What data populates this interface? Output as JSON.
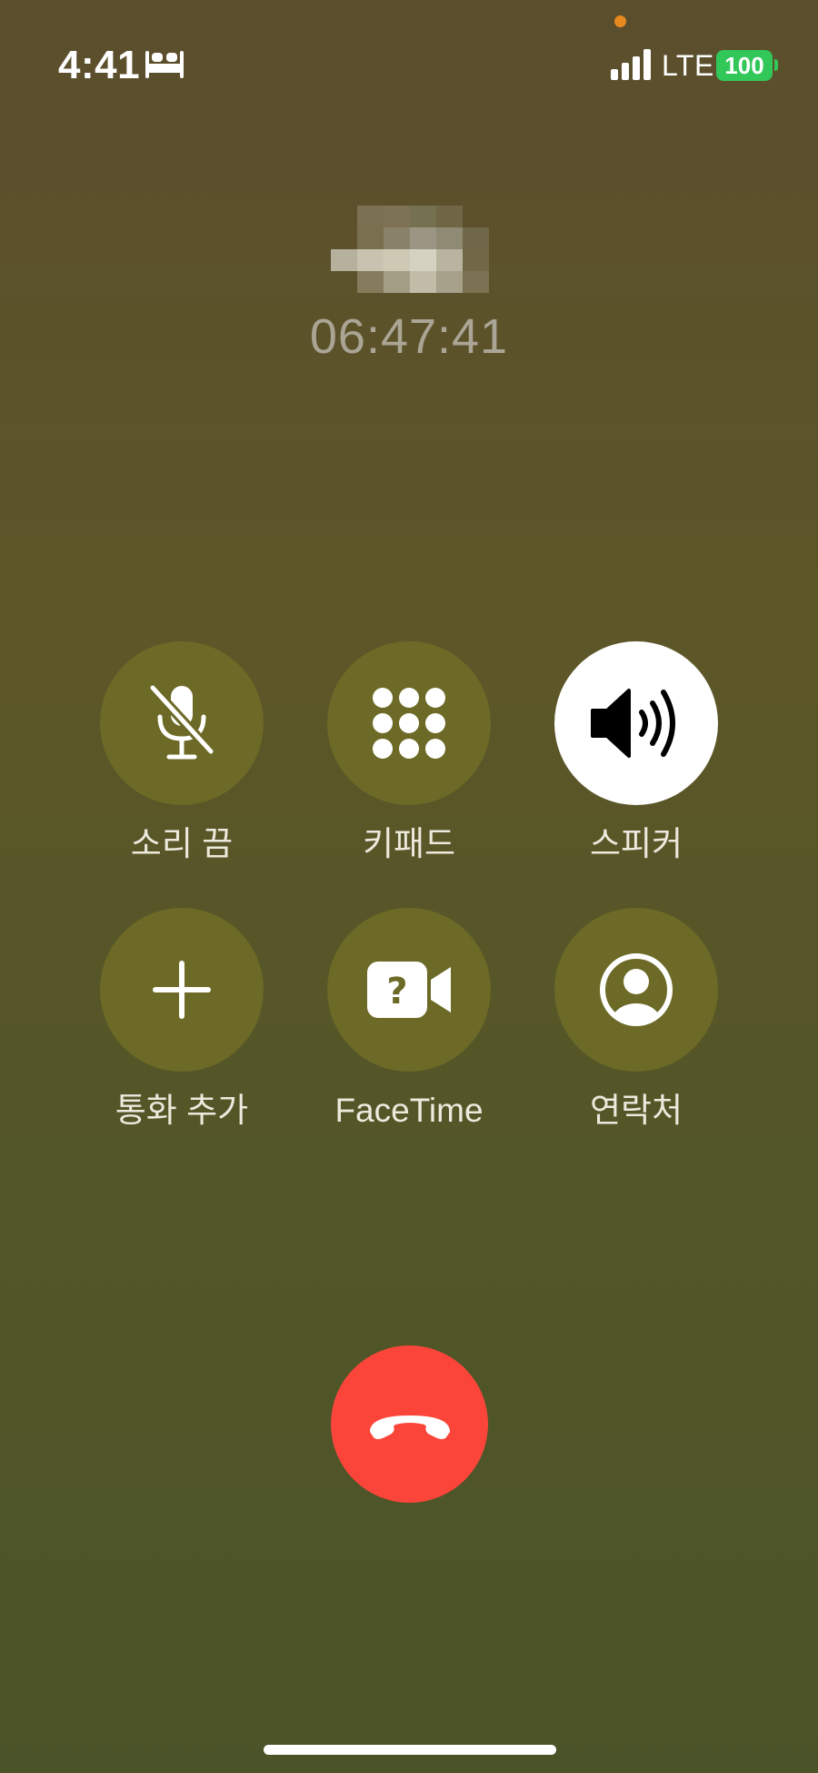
{
  "status_bar": {
    "time": "4:41",
    "network": "LTE",
    "battery_level": "100",
    "focus_icon": "bed-icon",
    "signal_icon": "cellular-signal-icon",
    "battery_color": "#32c759",
    "privacy_indicator_color": "#e8891f"
  },
  "call": {
    "caller_icon": "pixelated-caller-name",
    "duration": "06:47:41"
  },
  "controls": [
    {
      "label": "소리 끔",
      "icon": "mic-slash-icon",
      "active": false
    },
    {
      "label": "키패드",
      "icon": "keypad-icon",
      "active": false
    },
    {
      "label": "스피커",
      "icon": "speaker-wave-icon",
      "active": true
    },
    {
      "label": "통화 추가",
      "icon": "plus-icon",
      "active": false
    },
    {
      "label": "FaceTime",
      "icon": "facetime-video-icon",
      "active": false
    },
    {
      "label": "연락처",
      "icon": "contact-person-icon",
      "active": false
    }
  ],
  "end_call": {
    "icon": "phone-hangup-icon",
    "color": "#fc453a"
  },
  "theme": {
    "button_color": "#6c6a26",
    "active_button_color": "#ffffff",
    "timer_color": "#aaa595"
  }
}
